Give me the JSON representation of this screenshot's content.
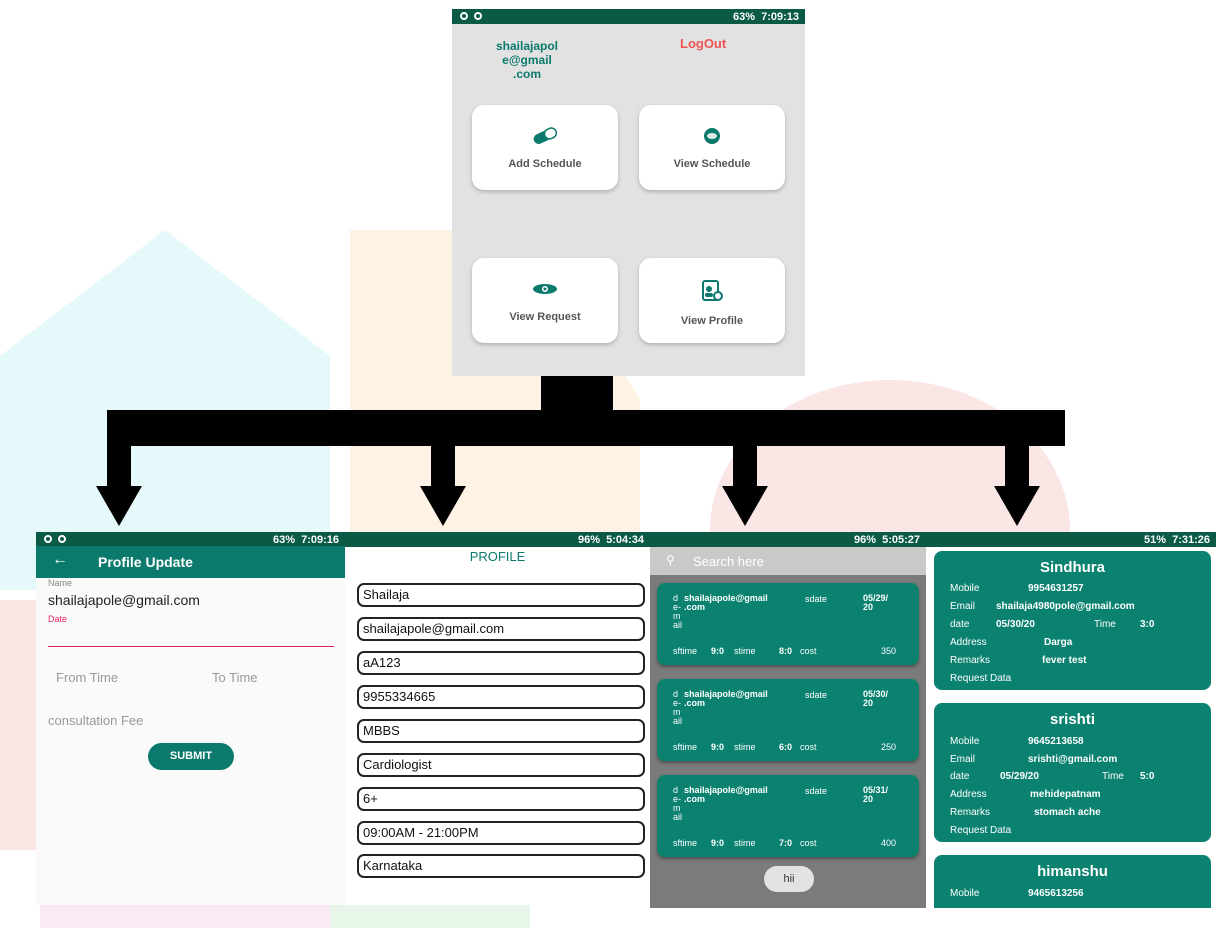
{
  "main_screen": {
    "status": {
      "battery": "63%",
      "time": "7:09:13"
    },
    "email_lines": [
      "shailajapol",
      "e@gmail",
      ".com"
    ],
    "logout_label": "LogOut",
    "cards": [
      {
        "label": "Add Schedule",
        "icon": "pill-icon"
      },
      {
        "label": "View Schedule",
        "icon": "disc-icon"
      },
      {
        "label": "View Request",
        "icon": "eye-icon"
      },
      {
        "label": "View Profile",
        "icon": "profile-card-icon"
      }
    ]
  },
  "profile_update": {
    "status": {
      "battery": "63%",
      "time": "7:09:16"
    },
    "title": "Profile Update",
    "name_label": "Name",
    "name_value": "shailajapole@gmail.com",
    "date_label": "Date",
    "from_time": "From Time",
    "to_time": "To Time",
    "fee_placeholder": "consultation Fee",
    "submit_label": "SUBMIT"
  },
  "profile": {
    "status": {
      "battery": "96%",
      "time": "5:04:34"
    },
    "title": "PROFILE",
    "fields": [
      "Shailaja",
      "shailajapole@gmail.com",
      "aA123",
      "9955334665",
      "MBBS",
      "Cardiologist",
      "6+",
      "09:00AM - 21:00PM",
      "Karnataka"
    ]
  },
  "schedule_list": {
    "status": {
      "battery": "96%",
      "time": "5:05:27"
    },
    "search_placeholder": "Search here",
    "items": [
      {
        "d": "d\ne-\nm\nail",
        "email": "shailajapole@gmail\n.com",
        "sdate_label": "sdate",
        "date": "05/29/\n20",
        "sftime_label": "sftime",
        "sftime": "9:0",
        "stime_label": "stime",
        "stime": "8:0",
        "cost_label": "cost",
        "cost": "350"
      },
      {
        "d": "d\ne-\nm\nail",
        "email": "shailajapole@gmail\n.com",
        "sdate_label": "sdate",
        "date": "05/30/\n20",
        "sftime_label": "sftime",
        "sftime": "9:0",
        "stime_label": "stime",
        "stime": "6:0",
        "cost_label": "cost",
        "cost": "250"
      },
      {
        "d": "d\ne-\nm\nail",
        "email": "shailajapole@gmail\n.com",
        "sdate_label": "sdate",
        "date": "05/31/\n20",
        "sftime_label": "sftime",
        "sftime": "9:0",
        "stime_label": "stime",
        "stime": "7:0",
        "cost_label": "cost",
        "cost": "400"
      }
    ],
    "bottom_button": "hii"
  },
  "requests": {
    "status": {
      "battery": "51%",
      "time": "7:31:26"
    },
    "items": [
      {
        "name": "Sindhura",
        "mobile_label": "Mobile",
        "mobile": "9954631257",
        "email_label": "Email",
        "email": "shailaja4980pole@gmail.com",
        "date_label": "date",
        "date": "05/30/20",
        "time_label": "Time",
        "time": "3:0",
        "address_label": "Address",
        "address": "Darga",
        "remarks_label": "Remarks",
        "remarks": "fever test",
        "request_label": "Request Data"
      },
      {
        "name": "srishti",
        "mobile_label": "Mobile",
        "mobile": "9645213658",
        "email_label": "Email",
        "email": "srishti@gmail.com",
        "date_label": "date",
        "date": "05/29/20",
        "time_label": "Time",
        "time": "5:0",
        "address_label": "Address",
        "address": "mehidepatnam",
        "remarks_label": "Remarks",
        "remarks": "stomach ache",
        "request_label": "Request Data"
      },
      {
        "name": "himanshu",
        "mobile_label": "Mobile",
        "mobile": "9465613256"
      }
    ]
  },
  "colors": {
    "teal": "#0b7a6c",
    "dark_teal": "#0b5a46",
    "logout_red": "#f05454",
    "accent_pink": "#e0245e"
  }
}
